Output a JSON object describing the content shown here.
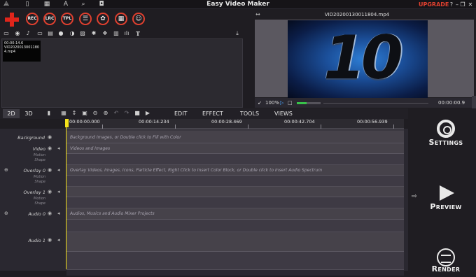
{
  "titlebar": {
    "app_title": "Easy Video Maker",
    "upgrade_label": "UPGRADE",
    "help": "?",
    "minimize": "–",
    "restore": "❐",
    "close": "✕",
    "icons": [
      "logo-icon",
      "project-icon",
      "grid-icon",
      "text-tool-icon",
      "search-icon",
      "shirt-icon"
    ]
  },
  "main_toolbar": {
    "add": "add-media",
    "buttons": [
      {
        "name": "record-button",
        "label": "REC"
      },
      {
        "name": "lrc-button",
        "label": "LRC"
      },
      {
        "name": "template-button",
        "label": "TPL"
      },
      {
        "name": "subtitle-list-button",
        "label": "☰"
      },
      {
        "name": "effects-button",
        "label": "✿"
      },
      {
        "name": "photo-edit-button",
        "label": "▦"
      },
      {
        "name": "user-button",
        "label": "☺"
      }
    ]
  },
  "media_toolbar_icons": [
    "▭",
    "◉",
    "♪",
    "▭",
    "▤",
    "●",
    "◑",
    "▨",
    "✱",
    "❖",
    "▥",
    "ılı",
    "T"
  ],
  "media_toolbar_import": "⤓",
  "media": {
    "items": [
      {
        "duration": "00:00:14.6",
        "name": "VID2020013001180 4.mp4"
      }
    ]
  },
  "preview": {
    "expand": "↔",
    "filename": "VID20200130011804.mp4",
    "overlay_text": "10",
    "shrink": "↙",
    "zoom": "100%",
    "play": "▷",
    "stop": "□",
    "timecode": "00:00:00.9"
  },
  "timeline_tabs": {
    "tab_2d": "2D",
    "tab_3d": "3D",
    "tool_icons": [
      "▮",
      "▦",
      "↕",
      "▣",
      "⊖",
      "⊕",
      "↶",
      "↷",
      "■",
      "▶"
    ],
    "menus": [
      {
        "name": "menu-edit",
        "label": "EDIT"
      },
      {
        "name": "menu-effect",
        "label": "EFFECT"
      },
      {
        "name": "menu-tools",
        "label": "TOOLS"
      },
      {
        "name": "menu-views",
        "label": "VIEWS"
      }
    ]
  },
  "ruler": {
    "marks": [
      "00:00:00.000",
      "00:00:14.234",
      "00:00:28.469",
      "00:00:42.704",
      "00:00:56.939"
    ]
  },
  "tracks": {
    "background": {
      "label": "Background",
      "hint": "Background Images, or Double click to Fill with Color"
    },
    "video": {
      "label": "Video",
      "sub1": "Motion",
      "sub2": "Shape",
      "hint": "Videos and Images"
    },
    "overlay0": {
      "label": "Overlay 0",
      "sub1": "Motion",
      "sub2": "Shape",
      "hint": "Overlay Videos, Images, Icons, Particle Effect, Right Click to Insert Color Block, or Double click to Insert Audio Spectrum"
    },
    "overlay1": {
      "label": "Overlay 1",
      "sub1": "Motion",
      "sub2": "Shape"
    },
    "audio0": {
      "label": "Audio 0",
      "hint": "Audios, Musics and Audio Mixer Projects"
    },
    "audio1": {
      "label": "Audio 1"
    }
  },
  "side": {
    "settings_big": "S",
    "settings_rest": "ETTINGS",
    "preview_big": "P",
    "preview_rest": "REVIEW",
    "render_big": "R",
    "render_rest": "ENDER",
    "collapse": "⇨"
  }
}
